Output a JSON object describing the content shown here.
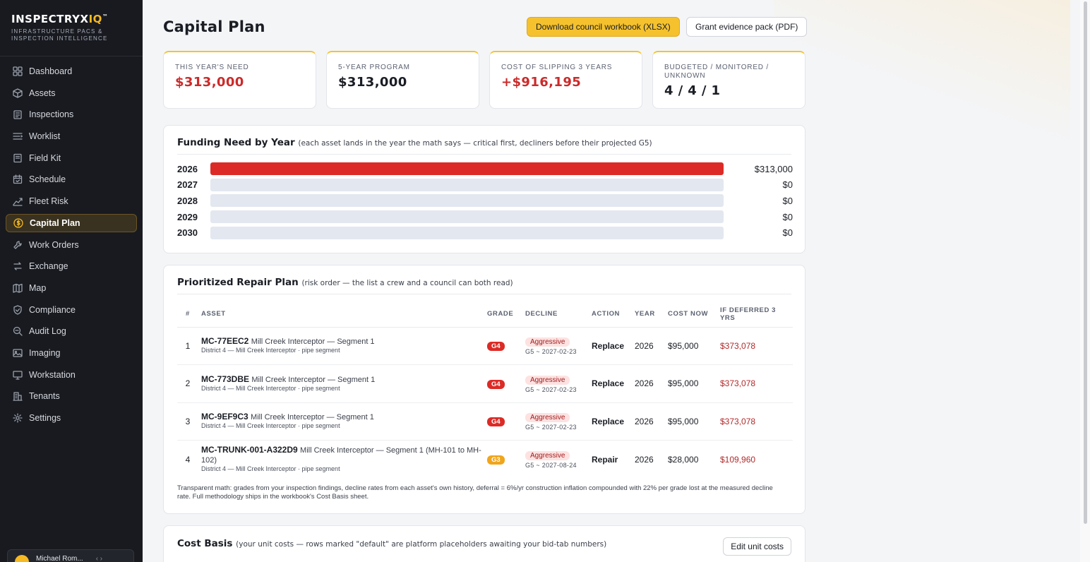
{
  "sidebar": {
    "brand_main": "INSPECTRYX",
    "brand_accent": "IQ",
    "brand_tm": "™",
    "brand_tag": "INFRASTRUCTURE PACS & INSPECTION INTELLIGENCE",
    "items": [
      {
        "label": "Dashboard",
        "icon": "grid-icon"
      },
      {
        "label": "Assets",
        "icon": "box-icon"
      },
      {
        "label": "Inspections",
        "icon": "clipboard-icon"
      },
      {
        "label": "Worklist",
        "icon": "list-icon"
      },
      {
        "label": "Field Kit",
        "icon": "notebook-icon"
      },
      {
        "label": "Schedule",
        "icon": "calendar-icon"
      },
      {
        "label": "Fleet Risk",
        "icon": "trend-icon"
      },
      {
        "label": "Capital Plan",
        "icon": "dollar-icon"
      },
      {
        "label": "Work Orders",
        "icon": "wrench-icon"
      },
      {
        "label": "Exchange",
        "icon": "swap-icon"
      },
      {
        "label": "Map",
        "icon": "map-icon"
      },
      {
        "label": "Compliance",
        "icon": "shield-check-icon"
      },
      {
        "label": "Audit Log",
        "icon": "search-icon"
      },
      {
        "label": "Imaging",
        "icon": "image-icon"
      },
      {
        "label": "Workstation",
        "icon": "monitor-icon"
      },
      {
        "label": "Tenants",
        "icon": "building-icon"
      },
      {
        "label": "Settings",
        "icon": "gear-icon"
      }
    ],
    "active_index": 7,
    "user_name": "Michael Rom..."
  },
  "header": {
    "title": "Capital Plan",
    "download_label": "Download council workbook (XLSX)",
    "grant_label": "Grant evidence pack (PDF)"
  },
  "kpis": [
    {
      "label": "THIS YEAR'S NEED",
      "value": "$313,000",
      "color": "#cc2a2a"
    },
    {
      "label": "5-YEAR PROGRAM",
      "value": "$313,000",
      "color": "#1a1d24"
    },
    {
      "label": "COST OF SLIPPING 3 YEARS",
      "value": "+$916,195",
      "color": "#cc2a2a"
    },
    {
      "label": "BUDGETED / MONITORED / UNKNOWN",
      "value": "4 / 4 / 1",
      "color": "#1a1d24"
    }
  ],
  "funding": {
    "title": "Funding Need by Year",
    "subtitle": "(each asset lands in the year the math says — critical first, decliners before their projected G5)",
    "rows": [
      {
        "year": "2026",
        "amount": 313000,
        "label": "$313,000"
      },
      {
        "year": "2027",
        "amount": 0,
        "label": "$0"
      },
      {
        "year": "2028",
        "amount": 0,
        "label": "$0"
      },
      {
        "year": "2029",
        "amount": 0,
        "label": "$0"
      },
      {
        "year": "2030",
        "amount": 0,
        "label": "$0"
      }
    ],
    "max": 313000,
    "bar_color": "#dc2b26"
  },
  "repair_plan": {
    "title": "Prioritized Repair Plan",
    "subtitle": "(risk order — the list a crew and a council can both read)",
    "columns": [
      "#",
      "ASSET",
      "GRADE",
      "DECLINE",
      "ACTION",
      "YEAR",
      "COST NOW",
      "IF DEFERRED 3 YRS"
    ],
    "rows": [
      {
        "n": "1",
        "id": "MC-77EEC2",
        "desc": "Mill Creek Interceptor — Segment 1",
        "sub": "District 4 — Mill Creek Interceptor · pipe segment",
        "grade": "G4",
        "decline": "Aggressive",
        "decline_sub": "G5 ~ 2027-02-23",
        "action": "Replace",
        "year": "2026",
        "cost": "$95,000",
        "deferred": "$373,078"
      },
      {
        "n": "2",
        "id": "MC-773DBE",
        "desc": "Mill Creek Interceptor — Segment 1",
        "sub": "District 4 — Mill Creek Interceptor · pipe segment",
        "grade": "G4",
        "decline": "Aggressive",
        "decline_sub": "G5 ~ 2027-02-23",
        "action": "Replace",
        "year": "2026",
        "cost": "$95,000",
        "deferred": "$373,078"
      },
      {
        "n": "3",
        "id": "MC-9EF9C3",
        "desc": "Mill Creek Interceptor — Segment 1",
        "sub": "District 4 — Mill Creek Interceptor · pipe segment",
        "grade": "G4",
        "decline": "Aggressive",
        "decline_sub": "G5 ~ 2027-02-23",
        "action": "Replace",
        "year": "2026",
        "cost": "$95,000",
        "deferred": "$373,078"
      },
      {
        "n": "4",
        "id": "MC-TRUNK-001-A322D9",
        "desc": "Mill Creek Interceptor — Segment 1 (MH-101 to MH-102)",
        "sub": "District 4 — Mill Creek Interceptor · pipe segment",
        "grade": "G3",
        "decline": "Aggressive",
        "decline_sub": "G5 ~ 2027-08-24",
        "action": "Repair",
        "year": "2026",
        "cost": "$28,000",
        "deferred": "$109,960"
      }
    ],
    "note": "Transparent math: grades from your inspection findings, decline rates from each asset's own history, deferral = 6%/yr construction inflation compounded with 22% per grade lost at the measured decline rate. Full methodology ships in the workbook's Cost Basis sheet."
  },
  "cost_basis": {
    "title": "Cost Basis",
    "subtitle": "(your unit costs — rows marked \"default\" are platform placeholders awaiting your bid-tab numbers)",
    "edit_label": "Edit unit costs"
  }
}
